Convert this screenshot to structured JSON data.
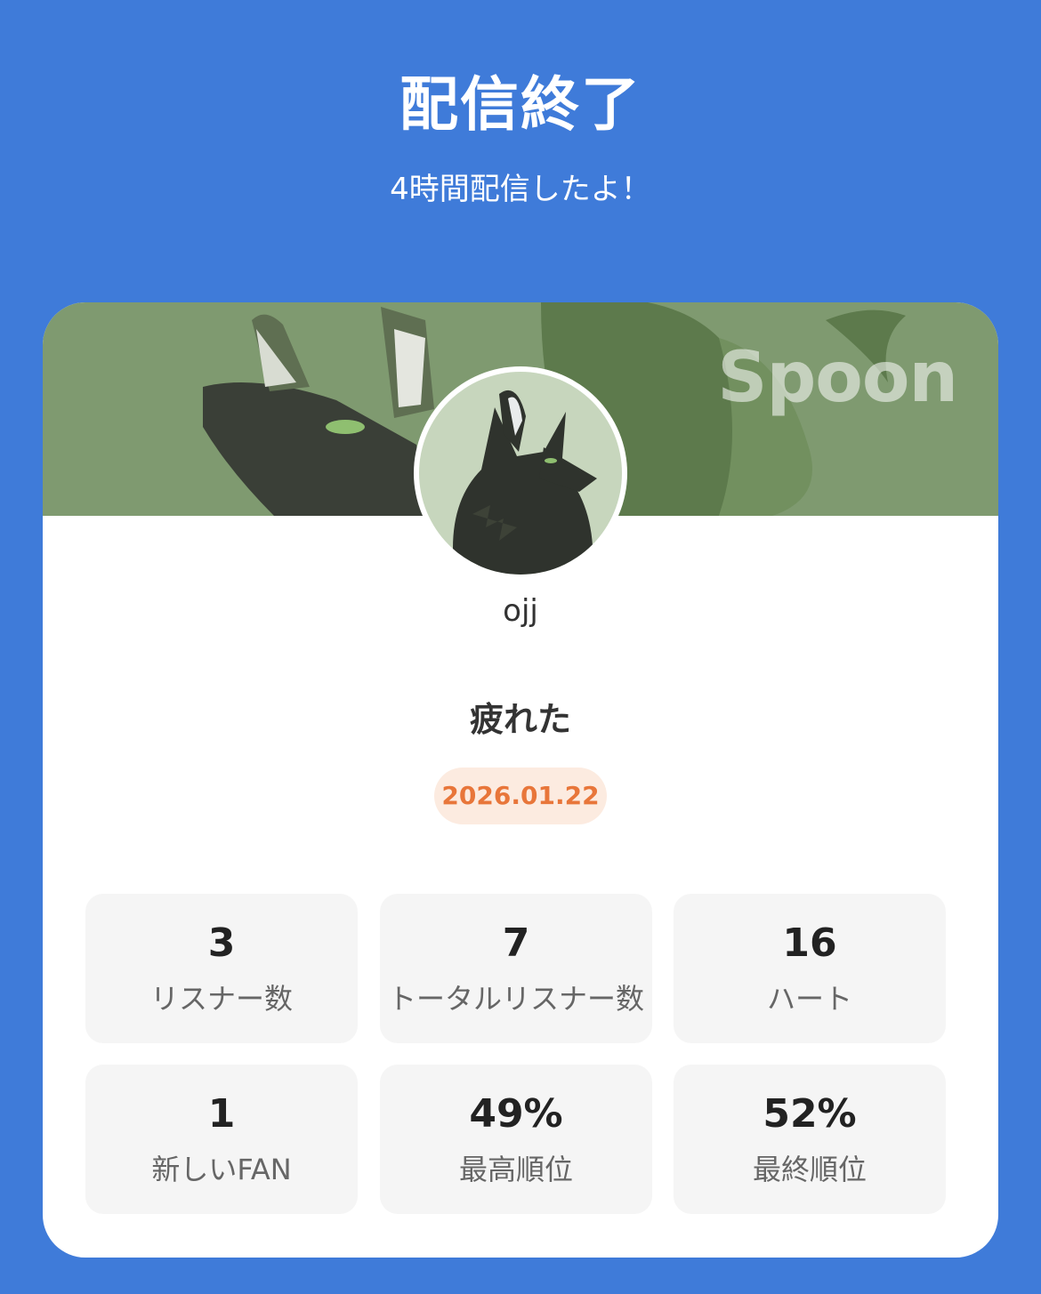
{
  "header": {
    "title": "配信終了",
    "subtitle": "4時間配信したよ！"
  },
  "card": {
    "watermark": "Spoon",
    "username": "ojj",
    "live_title": "疲れた",
    "date": "2026.01.22"
  },
  "stats": [
    {
      "value": "3",
      "label": "リスナー数"
    },
    {
      "value": "7",
      "label": "トータルリスナー数"
    },
    {
      "value": "16",
      "label": "ハート"
    },
    {
      "value": "1",
      "label": "新しいFAN"
    },
    {
      "value": "49%",
      "label": "最高順位"
    },
    {
      "value": "52%",
      "label": "最終順位"
    }
  ],
  "colors": {
    "background": "#3f7bd9",
    "date_pill_bg": "#fcebe0",
    "date_text": "#e8763a",
    "stat_bg": "#f5f5f5"
  }
}
